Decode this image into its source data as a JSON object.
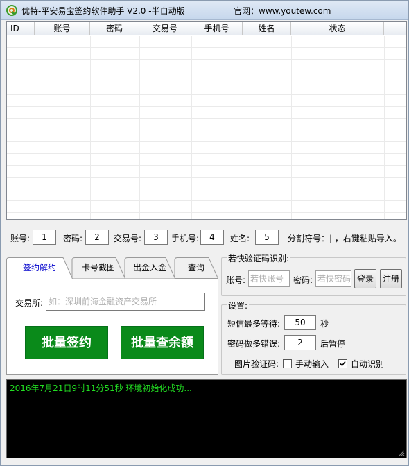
{
  "window": {
    "title": "优特-平安易宝签约软件助手 V2.0 -半自动版",
    "site": "官网：www.youtew.com"
  },
  "grid": {
    "columns": [
      "ID",
      "账号",
      "密码",
      "交易号",
      "手机号",
      "姓名",
      "状态"
    ]
  },
  "fields": {
    "account_label": "账号:",
    "account_value": "1",
    "password_label": "密码:",
    "password_value": "2",
    "tradeno_label": "交易号:",
    "tradeno_value": "3",
    "phone_label": "手机号:",
    "phone_value": "4",
    "name_label": "姓名:",
    "name_value": "5",
    "separator_text": "分割符号：| ，右键粘贴导入。"
  },
  "tabs": {
    "items": [
      "签约解约",
      "卡号截图",
      "出金入金",
      "查询"
    ],
    "active": 0,
    "exchange_label": "交易所:",
    "exchange_placeholder": "如：深圳前海金融资产交易所",
    "batch_sign": "批量签约",
    "batch_balance": "批量查余额"
  },
  "captcha": {
    "title": "若快验证码识别:",
    "account_label": "账号:",
    "account_placeholder": "若快账号",
    "password_label": "密码:",
    "password_placeholder": "若快密码",
    "login": "登录",
    "register": "注册"
  },
  "settings": {
    "title": "设置:",
    "sms_wait_label": "短信最多等待:",
    "sms_wait_value": "50",
    "sms_wait_unit": "秒",
    "pwd_errors_label": "密码做多错误:",
    "pwd_errors_value": "2",
    "pwd_errors_unit": "后暂停",
    "image_captcha_label": "图片验证码:",
    "manual_label": "手动输入",
    "manual_checked": false,
    "auto_label": "自动识别",
    "auto_checked": true
  },
  "console": {
    "log": "2016年7月21日9时11分51秒  环境初始化成功..."
  },
  "colors": {
    "button_green": "#0a8a1a",
    "console_text": "#22dd22",
    "active_tab_text": "#0000cc"
  }
}
